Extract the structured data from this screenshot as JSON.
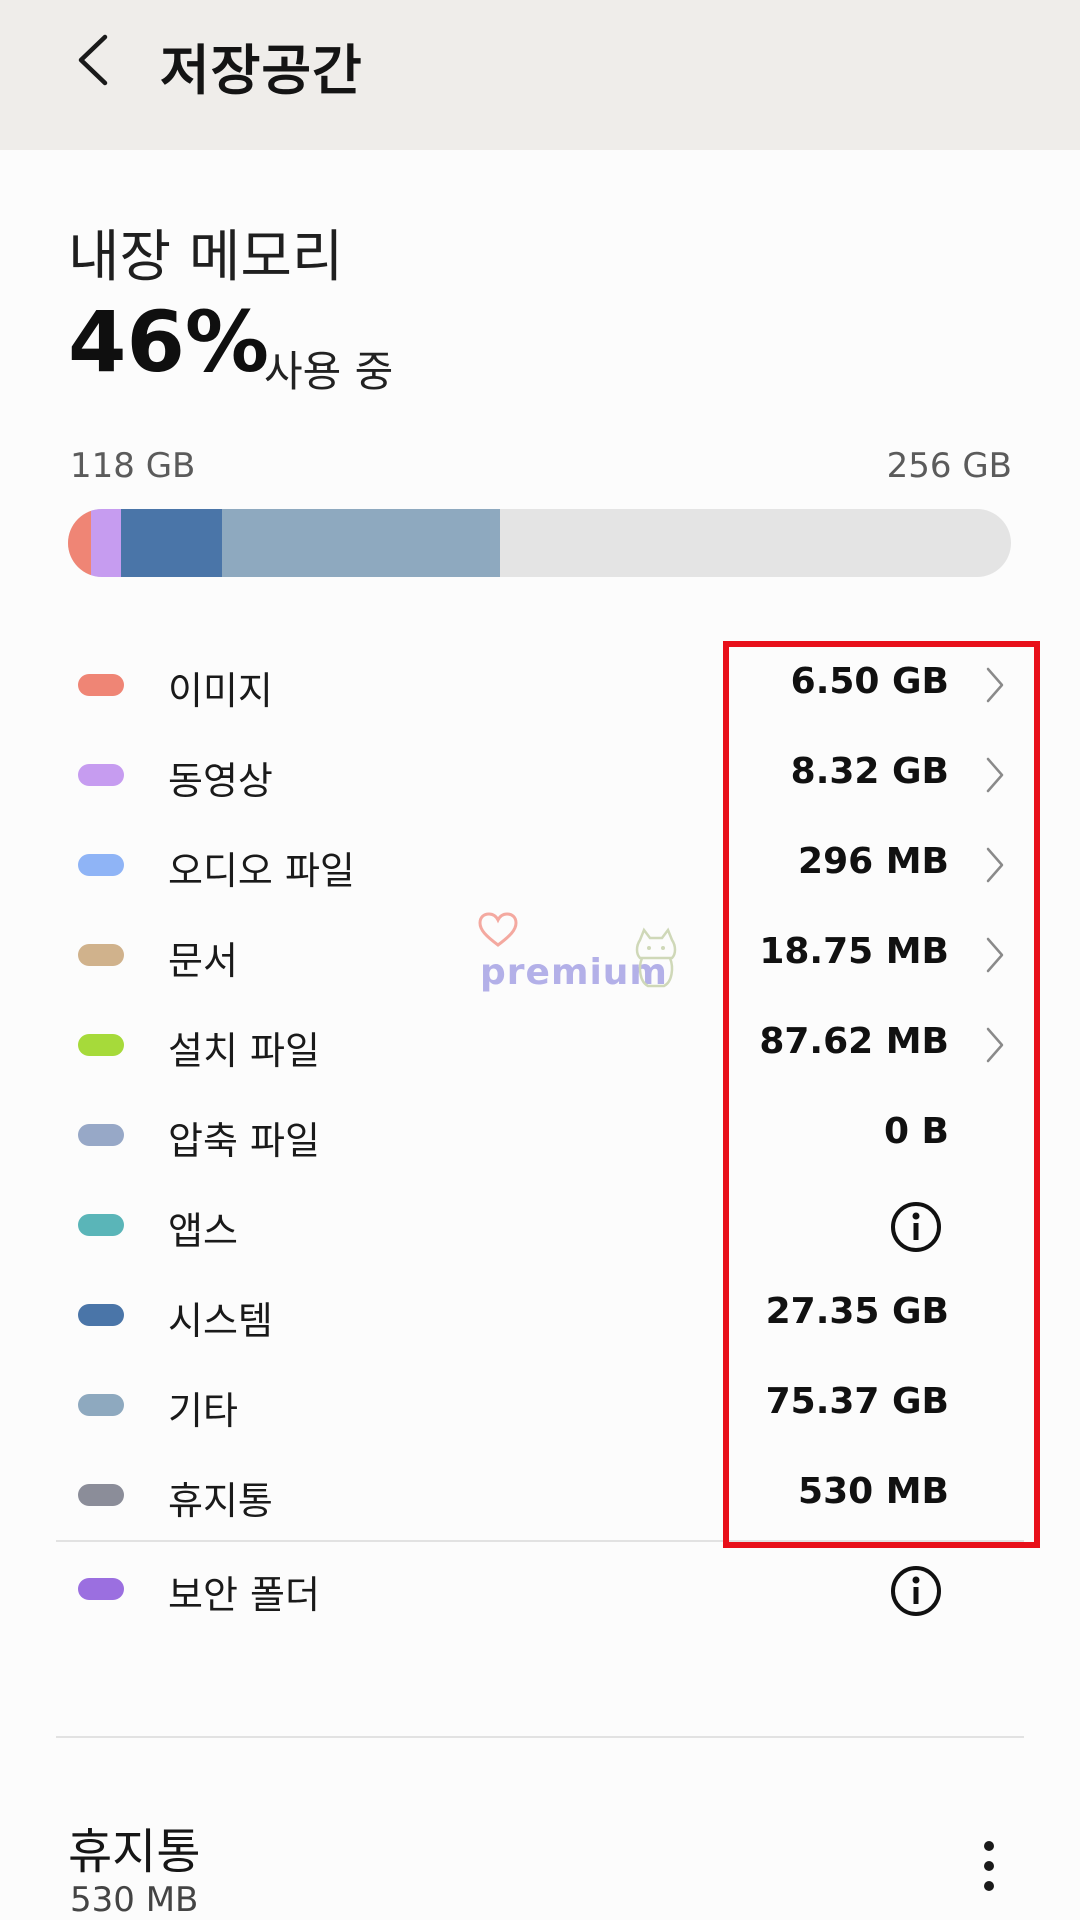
{
  "appbar": {
    "title": "저장공간"
  },
  "storage": {
    "section_title": "내장 메모리",
    "percent": "46%",
    "percent_suffix": "사용 중",
    "used_label": "118 GB",
    "total_label": "256 GB",
    "bar_segments": [
      {
        "name": "이미지",
        "color": "#ef8575",
        "fraction": 0.024
      },
      {
        "name": "동영상",
        "color": "#c69cf0",
        "fraction": 0.032
      },
      {
        "name": "시스템",
        "color": "#4a75a8",
        "fraction": 0.107
      },
      {
        "name": "기타",
        "color": "#8ea9bf",
        "fraction": 0.295
      }
    ],
    "bar_track_color": "#e4e4e4"
  },
  "categories": [
    {
      "label": "이미지",
      "value": "6.50 GB",
      "color": "#ef8575",
      "chevron": true
    },
    {
      "label": "동영상",
      "value": "8.32 GB",
      "color": "#c69cf0",
      "chevron": true
    },
    {
      "label": "오디오 파일",
      "value": "296 MB",
      "color": "#8fb4f6",
      "chevron": true
    },
    {
      "label": "문서",
      "value": "18.75 MB",
      "color": "#d0b28c",
      "chevron": true
    },
    {
      "label": "설치 파일",
      "value": "87.62 MB",
      "color": "#a6da3a",
      "chevron": true
    },
    {
      "label": "압축 파일",
      "value": "0 B",
      "color": "#97a8c7",
      "chevron": false
    },
    {
      "label": "앱스",
      "value": "",
      "color": "#5ab5b8",
      "chevron": false,
      "info_icon": "info-icon"
    },
    {
      "label": "시스템",
      "value": "27.35 GB",
      "color": "#4a75a8",
      "chevron": false
    },
    {
      "label": "기타",
      "value": "75.37 GB",
      "color": "#8ea9bf",
      "chevron": false
    },
    {
      "label": "휴지통",
      "value": "530 MB",
      "color": "#8b8d99",
      "chevron": false
    }
  ],
  "secure_folder": {
    "label": "보안 폴더",
    "color": "#9b6fe0",
    "icon": "info-icon"
  },
  "trash_section": {
    "title": "휴지통",
    "size": "530 MB"
  },
  "watermark": {
    "text": "premium"
  },
  "highlight_color": "#e8101a"
}
